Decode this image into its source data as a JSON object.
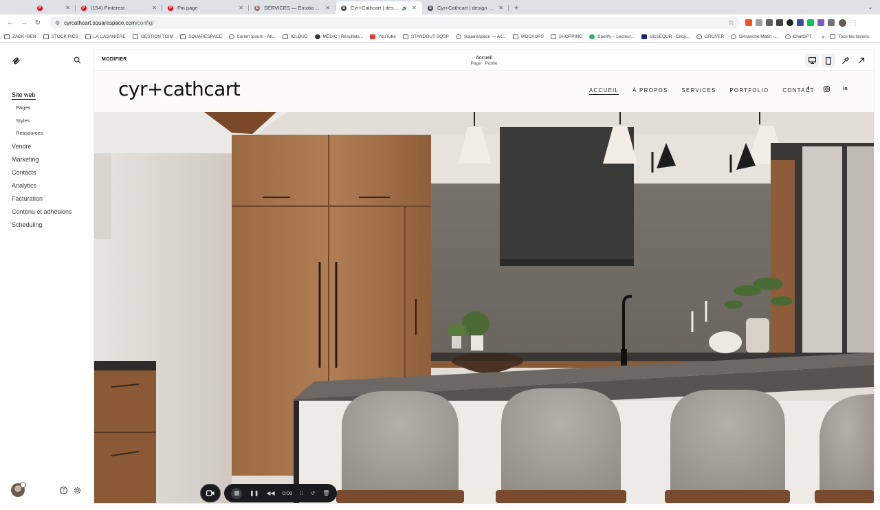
{
  "browser": {
    "tabs": [
      {
        "title": "",
        "active": false,
        "favicon_color": "#e60023",
        "favicon": "P"
      },
      {
        "title": "(154) Pinterest",
        "active": false,
        "favicon_color": "#e60023",
        "favicon": "P"
      },
      {
        "title": "Pin page",
        "active": false,
        "favicon_color": "#e60023",
        "favicon": "P"
      },
      {
        "title": "SERVICES — Émotions Gâteau",
        "active": false,
        "favicon_color": "#8d6e63",
        "favicon": "E"
      },
      {
        "title": "Cyr+Cathcart | design d'i",
        "active": true,
        "favicon_color": "#444444",
        "favicon": "S"
      },
      {
        "title": "Cyr+Cathcart | design d'inté",
        "active": false,
        "favicon_color": "#444444",
        "favicon": "S"
      }
    ],
    "url_host": "cyrcathcart.squarespace.com",
    "url_path": "/config/",
    "bookmarks": [
      {
        "label": "ZACK+BEN",
        "icon": "folder"
      },
      {
        "label": "STOCK PICS",
        "icon": "folder"
      },
      {
        "label": "LA CASANIÈRE",
        "icon": "folder"
      },
      {
        "label": "GESTION TGIM",
        "icon": "folder"
      },
      {
        "label": "SQUARESPACE",
        "icon": "folder"
      },
      {
        "label": "Lorem Ipsum - All...",
        "icon": "lorem"
      },
      {
        "label": "ICLOUD",
        "icon": "folder"
      },
      {
        "label": "MÉDIC | Résultats...",
        "icon": "dark"
      },
      {
        "label": "YouTube",
        "icon": "red"
      },
      {
        "label": "STANDOUT SQSP",
        "icon": "folder"
      },
      {
        "label": "Squarespace — Ac...",
        "icon": "round"
      },
      {
        "label": "MOCKUPS",
        "icon": "folder"
      },
      {
        "label": "SHOPPING",
        "icon": "folder"
      },
      {
        "label": "Spotify – Lecteur...",
        "icon": "green"
      },
      {
        "label": "clicSÉQUR - Citoy...",
        "icon": "navy"
      },
      {
        "label": "GROVER",
        "icon": "round"
      },
      {
        "label": "Dimanche Matin -...",
        "icon": "round"
      },
      {
        "label": "ChatGPT",
        "icon": "round"
      }
    ],
    "bookmarks_more": "»",
    "all_bookmarks": "Tous les favoris"
  },
  "sidebar": {
    "items": [
      {
        "label": "Site web",
        "level": "main",
        "active": true
      },
      {
        "label": "Pages",
        "level": "sub"
      },
      {
        "label": "Styles",
        "level": "sub"
      },
      {
        "label": "Ressources",
        "level": "sub"
      },
      {
        "label": "Vendre",
        "level": "main"
      },
      {
        "label": "Marketing",
        "level": "main"
      },
      {
        "label": "Contacts",
        "level": "main"
      },
      {
        "label": "Analytics",
        "level": "main"
      },
      {
        "label": "Facturation",
        "level": "main"
      },
      {
        "label": "Contenu et adhésions",
        "level": "main"
      },
      {
        "label": "Scheduling",
        "level": "main"
      }
    ]
  },
  "editor": {
    "modify_label": "MODIFIER",
    "page_name": "Accueil",
    "page_status": "Page · Publié"
  },
  "site": {
    "brand": "cyr+cathcart",
    "nav": [
      {
        "label": "ACCUEIL",
        "current": true
      },
      {
        "label": "À PROPOS",
        "current": false
      },
      {
        "label": "SERVICES",
        "current": false
      },
      {
        "label": "PORTFOLIO",
        "current": false
      },
      {
        "label": "CONTACT",
        "current": false
      }
    ],
    "socials": [
      {
        "name": "facebook-icon",
        "glyph": "f"
      },
      {
        "name": "instagram-icon",
        "glyph": ""
      },
      {
        "name": "linkedin-icon",
        "glyph": "in"
      }
    ]
  },
  "recorder": {
    "time": "0:00"
  },
  "colors": {
    "wood": "#a06e45",
    "stone": "#77726b",
    "hood": "#3a3a39",
    "counter": "#585350",
    "chair": "#a8a39c"
  }
}
